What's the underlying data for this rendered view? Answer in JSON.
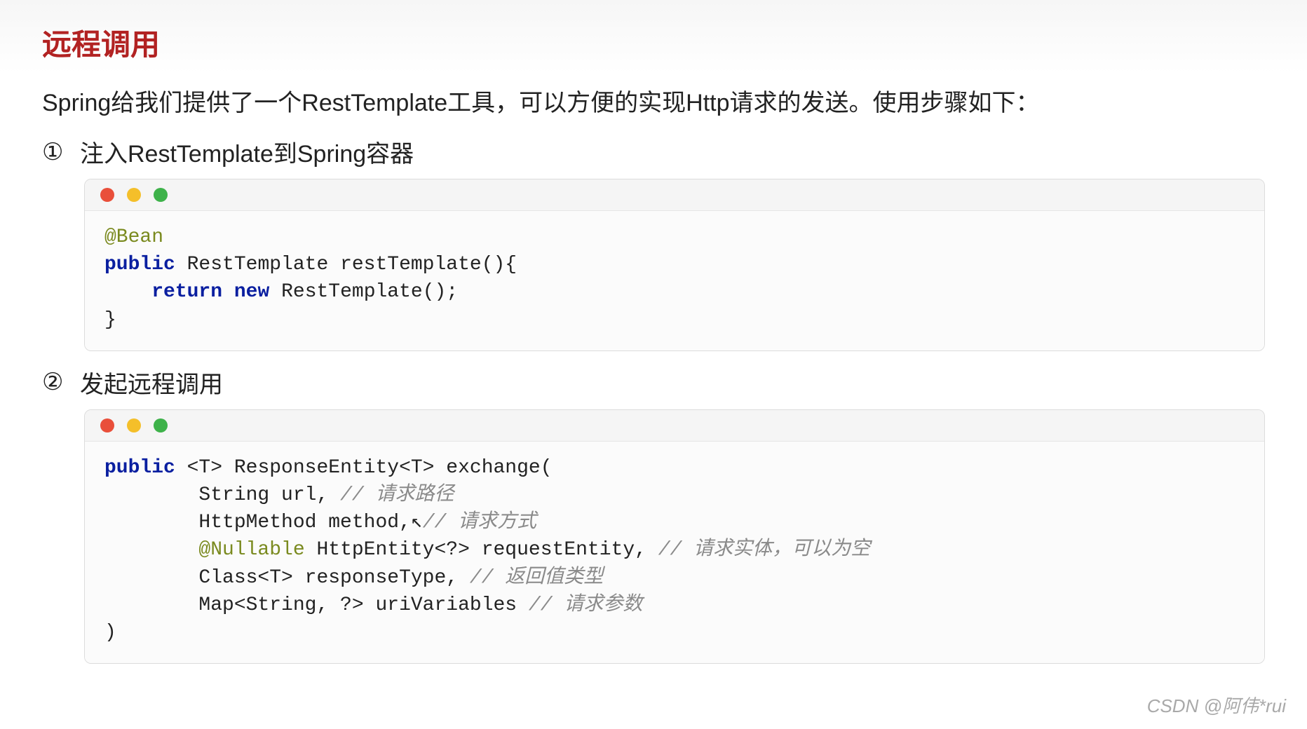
{
  "colors": {
    "heading": "#b22222",
    "dot_red": "#e94f3a",
    "dot_yellow": "#f4bf2a",
    "dot_green": "#3eb24a"
  },
  "heading": "远程调用",
  "intro": "Spring给我们提供了一个RestTemplate工具，可以方便的实现Http请求的发送。使用步骤如下：",
  "steps": [
    {
      "num": "①",
      "text": "注入RestTemplate到Spring容器"
    },
    {
      "num": "②",
      "text": "发起远程调用"
    }
  ],
  "code1": {
    "l1_annot": "@Bean",
    "l2_kw1": "public",
    "l2_rest": " RestTemplate restTemplate(){",
    "l3_indent": "    ",
    "l3_kw_return": "return",
    "l3_sp": " ",
    "l3_kw_new": "new",
    "l3_rest": " RestTemplate();",
    "l4": "}"
  },
  "code2": {
    "l1_kw": "public",
    "l1_rest": " <T> ResponseEntity<T> exchange(",
    "l2_indent": "        ",
    "l2_text": "String url, ",
    "l2_comment": "// 请求路径",
    "l3_indent": "        ",
    "l3_text": "HttpMethod method,",
    "l3_cursor": "↖",
    "l3_comment": "// 请求方式",
    "l4_indent": "        ",
    "l4_annot": "@Nullable",
    "l4_text": " HttpEntity<?> requestEntity, ",
    "l4_comment": "// 请求实体，可以为空",
    "l5_indent": "        ",
    "l5_text": "Class<T> responseType, ",
    "l5_comment": "// 返回值类型",
    "l6_indent": "        ",
    "l6_text": "Map<String, ?> uriVariables ",
    "l6_comment": "// 请求参数",
    "l7": ")"
  },
  "watermark": "CSDN @阿伟*rui"
}
